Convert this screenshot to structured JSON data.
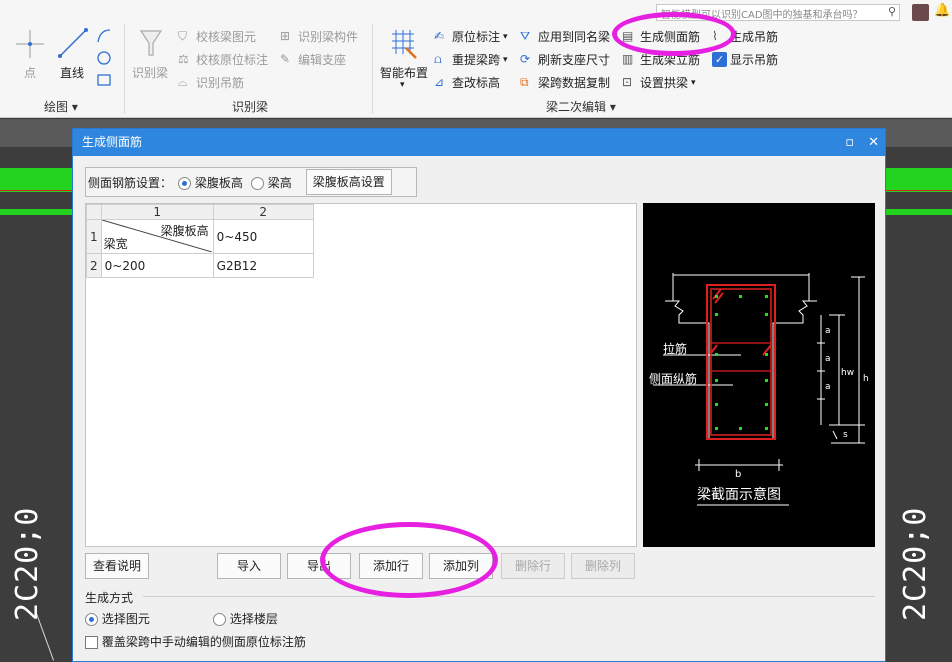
{
  "search": {
    "placeholder": "智能模型可以识别CAD图中的独基和承台吗？"
  },
  "ribbon": {
    "draw_group": {
      "label": "绘图",
      "point": "点",
      "line": "直线"
    },
    "recognize_group": {
      "label": "识别梁",
      "recognize_beam": "识别梁",
      "check_beam_element": "校核梁图元",
      "check_original_mark": "校核原位标注",
      "recognize_hanger": "识别吊筋",
      "recognize_beam_member": "识别梁构件",
      "edit_support": "编辑支座"
    },
    "beam_edit_group": {
      "label": "梁二次编辑",
      "smart_layout": "智能布置",
      "original_mark": "原位标注",
      "re_extract_span": "重提梁跨",
      "check_elevation": "查改标高",
      "apply_same_name": "应用到同名梁",
      "refresh_support_size": "刷新支座尺寸",
      "copy_span_data": "梁跨数据复制",
      "gen_side_rebar": "生成侧面筋",
      "gen_stirrup_rebar": "生成架立筋",
      "set_arch": "设置拱梁",
      "gen_hanger": "生成吊筋",
      "show_hanger": "显示吊筋"
    }
  },
  "canvas": {
    "left_text": "2C20;0",
    "right_text": "2C20;0"
  },
  "dialog": {
    "title": "生成侧面筋",
    "setting_label": "侧面钢筋设置：",
    "option_web_height": "梁腹板高",
    "option_beam_height": "梁高",
    "web_height_setting_btn": "梁腹板高设置",
    "table": {
      "col_numbers": [
        "1",
        "2"
      ],
      "row_numbers": [
        "1",
        "2"
      ],
      "corner_top": "梁腹板高",
      "corner_bottom": "梁宽",
      "header_value": "0~450",
      "rows": [
        {
          "width": "0~200",
          "value": "G2B12"
        }
      ]
    },
    "preview": {
      "tie_rebar": "拉筋",
      "side_long_rebar": "侧面纵筋",
      "caption": "梁截面示意图",
      "dims": {
        "a": "a",
        "hw": "hw",
        "h": "h",
        "s": "s",
        "b": "b"
      }
    },
    "buttons": {
      "view_desc": "查看说明",
      "import": "导入",
      "export": "导出",
      "add_row": "添加行",
      "add_col": "添加列",
      "delete_row": "删除行",
      "delete_col": "删除列"
    },
    "generation": {
      "label": "生成方式",
      "select_element": "选择图元",
      "select_floor": "选择楼层",
      "overwrite_text": "覆盖梁跨中手动编辑的侧面原位标注筋"
    }
  },
  "colors": {
    "accent": "#2e86de",
    "cad_green": "#22d420",
    "annotation": "#e620e0"
  }
}
